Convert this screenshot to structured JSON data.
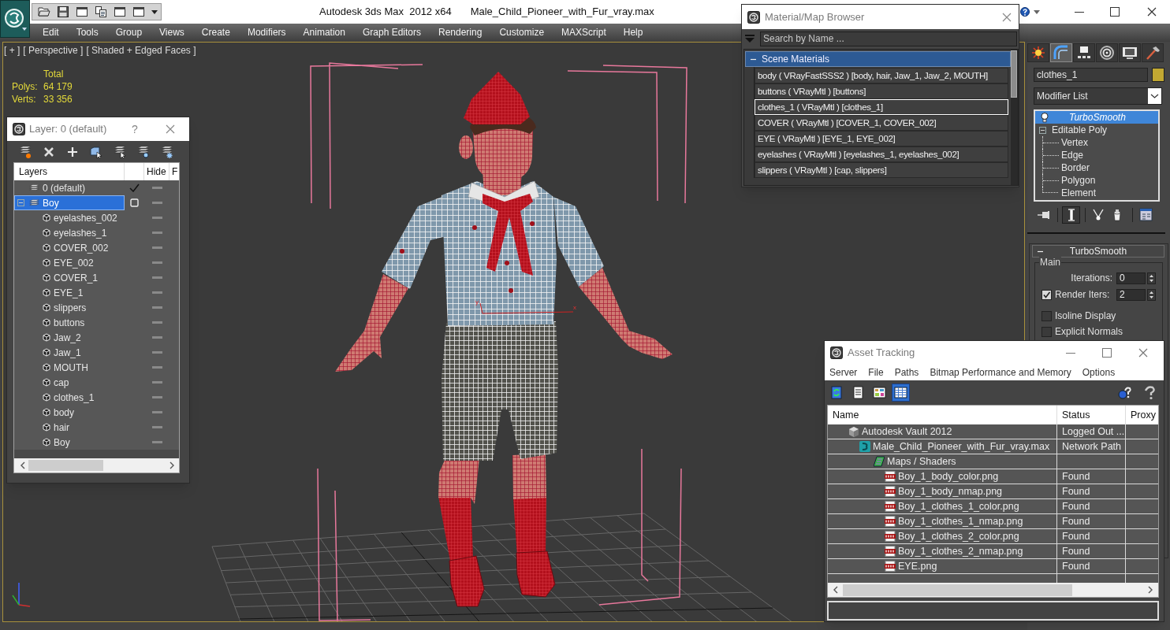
{
  "title_bar": {
    "app_title": "Autodesk 3ds Max  2012 x64",
    "file_name": "Male_Child_Pioneer_with_Fur_vray.max"
  },
  "menu_bar": [
    "Edit",
    "Tools",
    "Group",
    "Views",
    "Create",
    "Modifiers",
    "Animation",
    "Graph Editors",
    "Rendering",
    "Customize",
    "MAXScript",
    "Help"
  ],
  "viewport": {
    "labels": [
      "[ + ]",
      "[ Perspective ]",
      "[ Shaded + Edged Faces ]"
    ],
    "stats": {
      "header": "Total",
      "rows": [
        {
          "label": "Polys:",
          "value": "64 179"
        },
        {
          "label": "Verts:",
          "value": "33 356"
        }
      ]
    },
    "gizmo_axes": [
      "y",
      "x"
    ]
  },
  "layer_dialog": {
    "title": "Layer: 0 (default)",
    "help": "?",
    "columns": {
      "layers": "Layers",
      "hide": "Hide",
      "column_4": "F"
    },
    "layers": [
      {
        "name": "0 (default)",
        "kind": "layer",
        "current": true,
        "selected": false
      },
      {
        "name": "Boy",
        "kind": "layer",
        "current": false,
        "selected": true,
        "expanded": true,
        "children": [
          {
            "name": "eyelashes_002",
            "kind": "object",
            "selected": false
          },
          {
            "name": "eyelashes_1",
            "kind": "object",
            "selected": false
          },
          {
            "name": "COVER_002",
            "kind": "object",
            "selected": false
          },
          {
            "name": "EYE_002",
            "kind": "object",
            "selected": false
          },
          {
            "name": "COVER_1",
            "kind": "object",
            "selected": false
          },
          {
            "name": "EYE_1",
            "kind": "object",
            "selected": false
          },
          {
            "name": "slippers",
            "kind": "object",
            "selected": false
          },
          {
            "name": "buttons",
            "kind": "object",
            "selected": false
          },
          {
            "name": "Jaw_2",
            "kind": "object",
            "selected": false
          },
          {
            "name": "Jaw_1",
            "kind": "object",
            "selected": false
          },
          {
            "name": "MOUTH",
            "kind": "object",
            "selected": false
          },
          {
            "name": "cap",
            "kind": "object",
            "selected": false
          },
          {
            "name": "clothes_1",
            "kind": "object",
            "selected": false
          },
          {
            "name": "body",
            "kind": "object",
            "selected": false
          },
          {
            "name": "hair",
            "kind": "object",
            "selected": false
          },
          {
            "name": "Boy",
            "kind": "object",
            "selected": false
          }
        ]
      }
    ]
  },
  "material_browser": {
    "title": "Material/Map Browser",
    "search": {
      "placeholder": "Search by Name ..."
    },
    "groups": [
      {
        "label": "Scene Materials",
        "expanded": true,
        "items": [
          {
            "label": "body ( VRayFastSSS2 ) [body, hair, Jaw_1, Jaw_2, MOUTH]",
            "selected": false
          },
          {
            "label": "buttons ( VRayMtl ) [buttons]",
            "selected": false
          },
          {
            "label": "clothes_1 ( VRayMtl ) [clothes_1]",
            "selected": true
          },
          {
            "label": "COVER ( VRayMtl ) [COVER_1, COVER_002]",
            "selected": false
          },
          {
            "label": "EYE ( VRayMtl ) [EYE_1, EYE_002]",
            "selected": false
          },
          {
            "label": "eyelashes ( VRayMtl ) [eyelashes_1, eyelashes_002]",
            "selected": false
          },
          {
            "label": "slippers ( VRayMtl ) [cap, slippers]",
            "selected": false
          }
        ]
      }
    ]
  },
  "command_panel": {
    "tabs": [
      {
        "kind": "create",
        "selected": false
      },
      {
        "kind": "modify",
        "selected": true
      },
      {
        "kind": "hierarchy",
        "selected": false
      },
      {
        "kind": "motion",
        "selected": false
      },
      {
        "kind": "display",
        "selected": false
      },
      {
        "kind": "utilities",
        "selected": false
      }
    ],
    "object_name": "clothes_1",
    "modifier_list": "Modifier List",
    "modifier_stack": [
      {
        "label": "TurboSmooth",
        "kind": "modifier",
        "selected": true
      },
      {
        "label": "Editable Poly",
        "kind": "base",
        "selected": false,
        "expanded": true,
        "children": [
          {
            "label": "Vertex",
            "selected": false
          },
          {
            "label": "Edge",
            "selected": false
          },
          {
            "label": "Border",
            "selected": false
          },
          {
            "label": "Polygon",
            "selected": false
          },
          {
            "label": "Element",
            "selected": false
          }
        ]
      }
    ],
    "rollout": {
      "title": "TurboSmooth",
      "expanded": true,
      "group": "Main",
      "controls": [
        {
          "kind": "spinner",
          "label": "Iterations:",
          "value": "0"
        },
        {
          "kind": "checkbox_spinner",
          "label": "Render Iters:",
          "value": "2",
          "checked": true
        },
        {
          "kind": "checkbox",
          "label": "Isoline Display",
          "checked": false
        },
        {
          "kind": "checkbox",
          "label": "Explicit Normals",
          "checked": false
        }
      ]
    }
  },
  "asset_tracking": {
    "title": "Asset Tracking",
    "menu": [
      "Server",
      "File",
      "Paths",
      "Bitmap Performance and Memory",
      "Options"
    ],
    "toolbar": [
      {
        "kind": "refresh",
        "selected": false
      },
      {
        "kind": "list",
        "selected": false
      },
      {
        "kind": "thumbnails",
        "selected": false
      },
      {
        "kind": "table",
        "selected": true
      }
    ],
    "columns": [
      "Name",
      "Status",
      "Proxy"
    ],
    "tree": [
      {
        "name": "Autodesk Vault 2012",
        "kind": "vault",
        "status": "Logged Out ...",
        "selected": false,
        "children": [
          {
            "name": "Male_Child_Pioneer_with_Fur_vray.max",
            "kind": "scene",
            "status": "Network Path",
            "selected": false,
            "children": [
              {
                "name": "Maps / Shaders",
                "kind": "maps",
                "selected": false,
                "children": [
                  {
                    "name": "Boy_1_body_color.png",
                    "kind": "png",
                    "status": "Found",
                    "selected": false
                  },
                  {
                    "name": "Boy_1_body_nmap.png",
                    "kind": "png",
                    "status": "Found",
                    "selected": false
                  },
                  {
                    "name": "Boy_1_clothes_1_color.png",
                    "kind": "png",
                    "status": "Found",
                    "selected": false
                  },
                  {
                    "name": "Boy_1_clothes_1_nmap.png",
                    "kind": "png",
                    "status": "Found",
                    "selected": false
                  },
                  {
                    "name": "Boy_1_clothes_2_color.png",
                    "kind": "png",
                    "status": "Found",
                    "selected": false
                  },
                  {
                    "name": "Boy_1_clothes_2_nmap.png",
                    "kind": "png",
                    "status": "Found",
                    "selected": false
                  },
                  {
                    "name": "EYE.png",
                    "kind": "png",
                    "status": "Found",
                    "selected": false
                  }
                ]
              }
            ]
          }
        ]
      }
    ]
  }
}
